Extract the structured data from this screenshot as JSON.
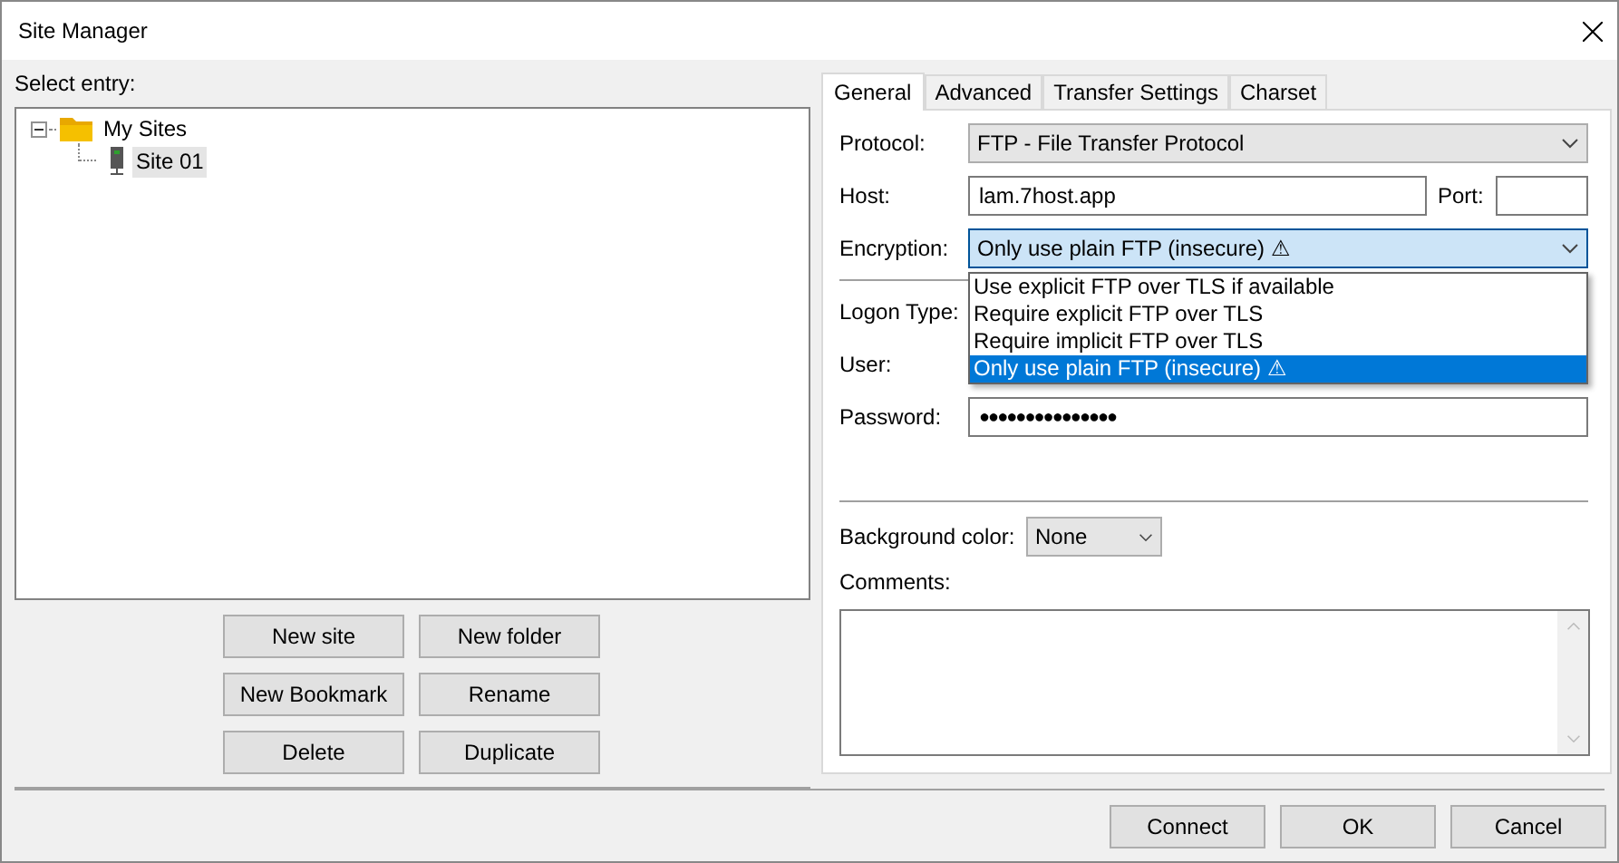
{
  "window": {
    "title": "Site Manager"
  },
  "entries": {
    "label": "Select entry:",
    "tree": [
      {
        "label": "My Sites",
        "kind": "folder",
        "expanded": true,
        "selected": false,
        "children": [
          {
            "label": "Site 01",
            "kind": "site",
            "selected": true
          }
        ]
      }
    ]
  },
  "entry_buttons": [
    "New site",
    "New folder",
    "New Bookmark",
    "Rename",
    "Delete",
    "Duplicate"
  ],
  "tabs": [
    {
      "label": "General",
      "selected": true
    },
    {
      "label": "Advanced",
      "selected": false
    },
    {
      "label": "Transfer Settings",
      "selected": false
    },
    {
      "label": "Charset",
      "selected": false
    }
  ],
  "general": {
    "protocol": {
      "label": "Protocol:",
      "value": "FTP - File Transfer Protocol"
    },
    "host": {
      "label": "Host:",
      "value": "lam.7host.app"
    },
    "port": {
      "label": "Port:"
    },
    "encryption": {
      "label": "Encryption:",
      "value": "Only use plain FTP (insecure) ⚠",
      "open": true,
      "options": [
        {
          "label": "Use explicit FTP over TLS if available",
          "selected": false
        },
        {
          "label": "Require explicit FTP over TLS",
          "selected": false
        },
        {
          "label": "Require implicit FTP over TLS",
          "selected": false
        },
        {
          "label": "Only use plain FTP (insecure) ⚠",
          "selected": true
        }
      ]
    },
    "logon_type": {
      "label": "Logon Type:"
    },
    "user": {
      "label": "User:"
    },
    "password": {
      "label": "Password:",
      "value": "●●●●●●●●●●●●●●●"
    },
    "background_color": {
      "label": "Background color:",
      "value": "None"
    },
    "comments": {
      "label": "Comments:"
    }
  },
  "dialog_buttons": [
    "Connect",
    "OK",
    "Cancel"
  ]
}
